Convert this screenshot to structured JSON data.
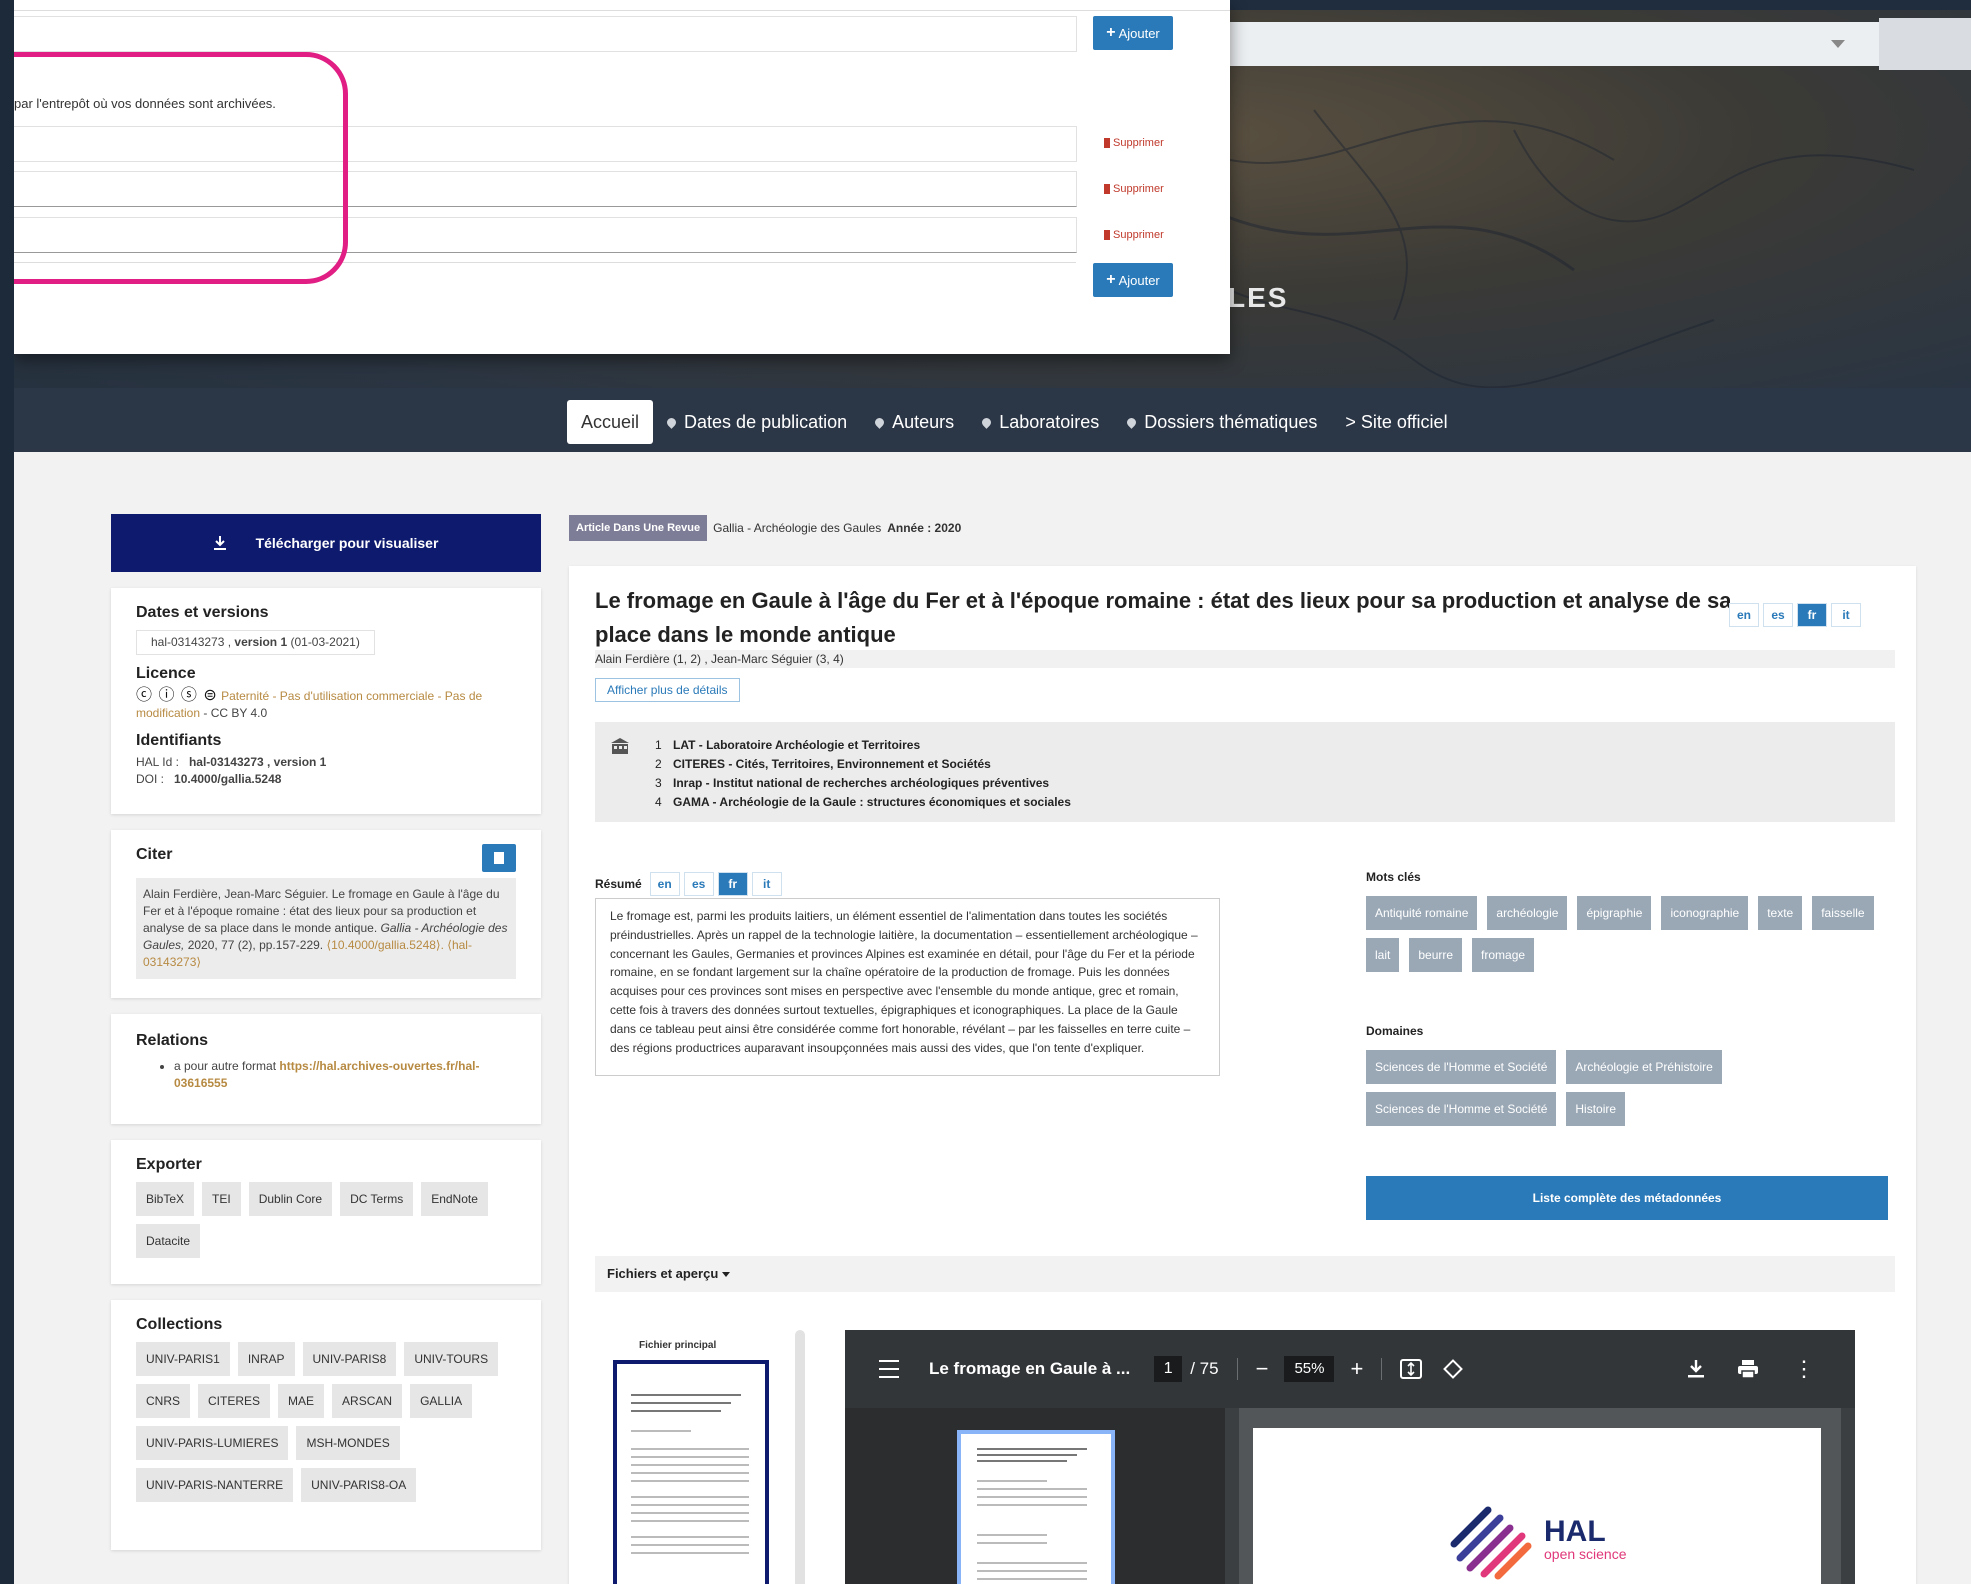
{
  "hero": {
    "title_fragment": "LES"
  },
  "nav": {
    "items": [
      {
        "label": "Accueil",
        "active": true,
        "pin": false
      },
      {
        "label": "Dates de publication",
        "pin": true
      },
      {
        "label": "Auteurs",
        "pin": true
      },
      {
        "label": "Laboratoires",
        "pin": true
      },
      {
        "label": "Dossiers thématiques",
        "pin": true
      },
      {
        "label": "> Site officiel",
        "pin": false
      }
    ]
  },
  "overlay": {
    "add_label": "Ajouter",
    "help_text": "par l'entrepôt où vos données sont archivées.",
    "delete_label": "Supprimer"
  },
  "download": {
    "label": "Télécharger pour visualiser"
  },
  "dates": {
    "title": "Dates et versions",
    "hal_id": "hal-03143273",
    "version": "version 1",
    "date": "(01-03-2021)"
  },
  "licence": {
    "title": "Licence",
    "text": "Paternité - Pas d'utilisation commerciale - Pas de modification",
    "suffix": "- CC BY 4.0"
  },
  "identifiants": {
    "title": "Identifiants",
    "hal_label": "HAL Id :",
    "hal_value": "hal-03143273 , version 1",
    "doi_label": "DOI :",
    "doi_value": "10.4000/gallia.5248"
  },
  "citer": {
    "title": "Citer",
    "text_main": "Alain Ferdière, Jean-Marc Séguier. Le fromage en Gaule à l'âge du Fer et à l'époque romaine : état des lieux pour sa production et analyse de sa place dans le monde antique.",
    "journal": "Gallia - Archéologie des Gaules,",
    "details": "2020, 77 (2), pp.157-229.",
    "links": "⟨10.4000/gallia.5248⟩. ⟨hal-03143273⟩"
  },
  "relations": {
    "title": "Relations",
    "item_prefix": "a pour autre format",
    "item_link": "https://hal.archives-ouvertes.fr/hal-03616555"
  },
  "exporter": {
    "title": "Exporter",
    "formats": [
      "BibTeX",
      "TEI",
      "Dublin Core",
      "DC Terms",
      "EndNote",
      "Datacite"
    ]
  },
  "collections": {
    "title": "Collections",
    "items": [
      "UNIV-PARIS1",
      "INRAP",
      "UNIV-PARIS8",
      "UNIV-TOURS",
      "CNRS",
      "CITERES",
      "MAE",
      "ARSCAN",
      "GALLIA",
      "UNIV-PARIS-LUMIERES",
      "MSH-MONDES",
      "UNIV-PARIS-NANTERRE",
      "UNIV-PARIS8-OA"
    ]
  },
  "article": {
    "type": "Article Dans Une Revue",
    "journal": "Gallia - Archéologie des Gaules",
    "year_label": "Année : 2020",
    "title": "Le fromage en Gaule à l'âge du Fer et à l'époque romaine : état des lieux pour sa production et analyse de sa place dans le monde antique",
    "langs": [
      "en",
      "es",
      "fr",
      "it"
    ],
    "active_lang": "fr",
    "authors": "Alain Ferdière (1, 2) , Jean-Marc Séguier (3, 4)",
    "more_details": "Afficher plus de détails",
    "labs": [
      {
        "n": "1",
        "name": "LAT - Laboratoire Archéologie et Territoires"
      },
      {
        "n": "2",
        "name": "CITERES - Cités, Territoires, Environnement et Sociétés"
      },
      {
        "n": "3",
        "name": "Inrap - Institut national de recherches archéologiques préventives"
      },
      {
        "n": "4",
        "name": "GAMA - Archéologie de la Gaule : structures économiques et sociales"
      }
    ],
    "resume_label": "Résumé",
    "abstract": "Le fromage est, parmi les produits laitiers, un élément essentiel de l'alimentation dans toutes les sociétés préindustrielles. Après un rappel de la technologie laitière, la documentation – essentiellement archéologique – concernant les Gaules, Germanies et provinces Alpines est examinée en détail, pour l'âge du Fer et la période romaine, en se fondant largement sur la chaîne opératoire de la production de fromage. Puis les données acquises pour ces provinces sont mises en perspective avec l'ensemble du monde antique, grec et romain, cette fois à travers des données surtout textuelles, épigraphiques et iconographiques. La place de la Gaule dans ce tableau peut ainsi être considérée comme fort honorable, révélant – par les faisselles en terre cuite – des régions productrices auparavant insoupçonnées mais aussi des vides, que l'on tente d'expliquer.",
    "keywords_title": "Mots clés",
    "keywords": [
      "Antiquité romaine",
      "archéologie",
      "épigraphie",
      "iconographie",
      "texte",
      "faisselle",
      "lait",
      "beurre",
      "fromage"
    ],
    "domains_title": "Domaines",
    "domains": [
      "Sciences de l'Homme et Société",
      "Archéologie et Préhistoire",
      "Sciences de l'Homme et Société",
      "Histoire"
    ],
    "metadata_btn": "Liste complète des métadonnées",
    "files_title": "Fichiers et aperçu",
    "file_label": "Fichier principal"
  },
  "pdf": {
    "title": "Le fromage en Gaule à ...",
    "page": "1",
    "total": "/ 75",
    "zoom": "55%",
    "logo_word": "HAL",
    "logo_sub": "open science"
  },
  "colors": {
    "accent": "#2a7ab9",
    "download": "#0e1a6e",
    "highlight": "#e01e83",
    "chip": "#9aa8b6"
  }
}
